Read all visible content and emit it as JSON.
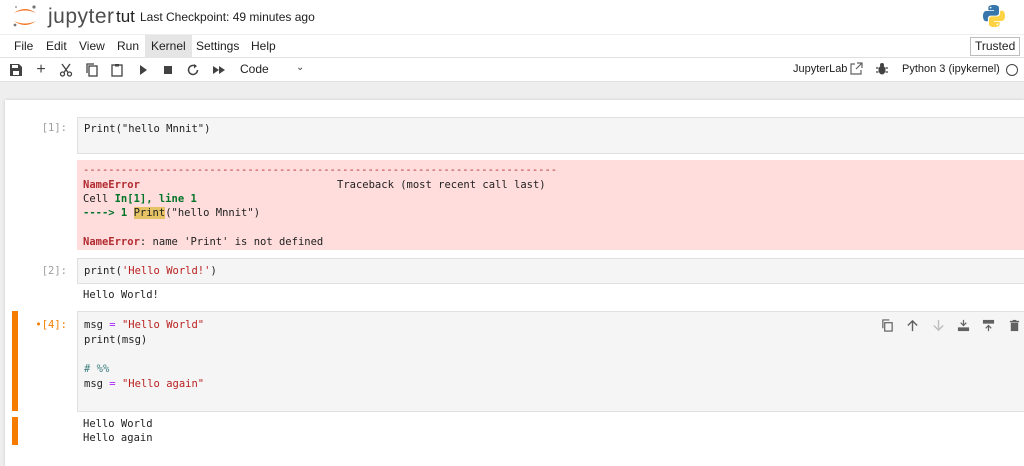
{
  "app": {
    "logo_text": "jupyter",
    "notebook_name": "tut",
    "checkpoint": "Last Checkpoint: 49 minutes ago"
  },
  "menu": {
    "items": [
      "File",
      "Edit",
      "View",
      "Run",
      "Kernel",
      "Settings",
      "Help"
    ],
    "active": "Kernel",
    "trusted": "Trusted"
  },
  "toolbar": {
    "icons": [
      "save-icon",
      "add-cell-icon",
      "cut-icon",
      "copy-icon",
      "paste-icon",
      "run-icon",
      "stop-icon",
      "restart-icon",
      "fast-forward-icon"
    ],
    "cell_type": "Code",
    "jupyterlab_link": "JupyterLab",
    "kernel_name": "Python 3 (ipykernel)"
  },
  "cells": [
    {
      "prompt": "[1]:",
      "code": "Print(\"hello Mnnit\")",
      "error": {
        "dashes": "---------------------------------------------------------------------------",
        "name": "NameError",
        "traceback": "Traceback (most recent call last)",
        "cell_prefix": "Cell ",
        "cell_ref": "In[1], line 1",
        "arrow": "----> 1 ",
        "print_word": "Print",
        "arg": "(\"hello Mnnit\")",
        "message": ": name 'Print' is not defined"
      }
    },
    {
      "prompt": "[2]:",
      "code_fn": "print(",
      "code_str": "'Hello World!'",
      "code_end": ")",
      "output": "Hello World!"
    },
    {
      "prompt": "•[4]:",
      "line1_var": "msg ",
      "line1_op": "=",
      "line1_str": " \"Hello World\"",
      "line2": "print(msg)",
      "line3": "# %%",
      "line4_var": "msg ",
      "line4_op": "=",
      "line4_str": " \"Hello again\"",
      "output": [
        "Hello World",
        "Hello again"
      ]
    }
  ],
  "colors": {
    "accent": "#f57c00",
    "error_bg": "#ffdddd"
  }
}
